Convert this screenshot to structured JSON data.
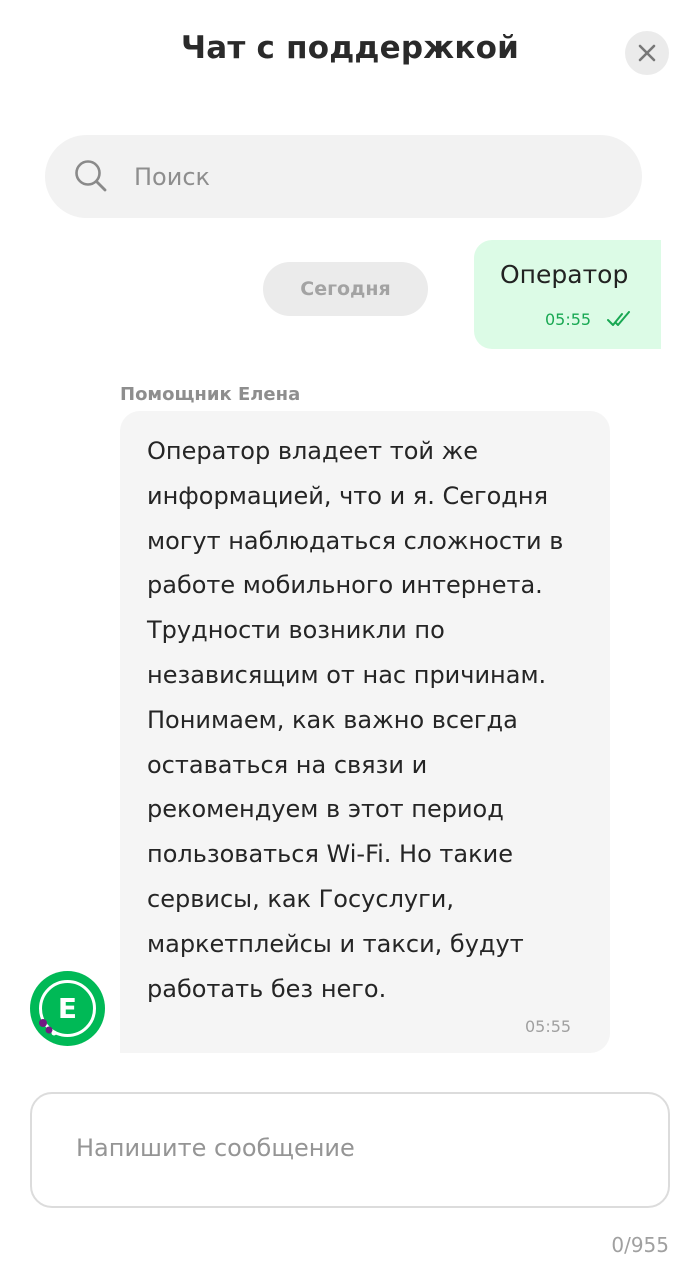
{
  "header": {
    "title": "Чат с поддержкой",
    "close_icon": "close-icon"
  },
  "search": {
    "placeholder": "Поиск",
    "value": "",
    "icon": "search-icon"
  },
  "chat": {
    "date_divider": "Сегодня",
    "messages": [
      {
        "from": "user",
        "text": "Оператор",
        "time": "05:55",
        "status_icon": "double-check-icon"
      },
      {
        "from": "bot",
        "sender": "Помощник Елена",
        "avatar_letter": "Е",
        "text": "Оператор владеет той же информацией, что и я. Сегодня могут наблюдаться сложности в работе мобильного интернета. Трудности возникли по независящим от нас причинам. Понимаем, как важно всегда оставаться на связи и рекомендуем в этот период пользоваться Wi-Fi. Но такие сервисы, как Госуслуги, маркетплейсы и такси, будут работать без него.",
        "time": "05:55"
      }
    ]
  },
  "composer": {
    "placeholder": "Напишите сообщение",
    "value": "",
    "counter": "0/955"
  },
  "colors": {
    "accent": "#00b956",
    "user_bubble": "#dcfbe6",
    "bot_bubble": "#f5f5f5",
    "time_green": "#19a853",
    "avatar_dots": "#731982"
  }
}
